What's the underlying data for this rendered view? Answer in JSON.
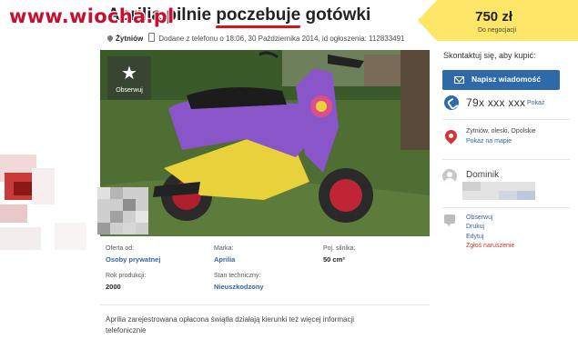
{
  "watermark": "www.wiocha.pl",
  "ad": {
    "title_prefix": "Aprilia pilnie ",
    "title_underlined": "poczebuje",
    "title_suffix": " gotówki",
    "location_short": "Żytniów",
    "meta": "Dodane z telefonu o 18:06, 30 Października 2014, id ogłoszenia: 112833491"
  },
  "price": {
    "amount": "750 zł",
    "note": "Do negocjacji"
  },
  "photo": {
    "observe_label": "Obserwuj",
    "colors": {
      "grass": "#4f6e33",
      "body": "#8a55c8",
      "accent_yellow": "#e8d13a",
      "wheel": "#c02536"
    }
  },
  "details": {
    "offer_from_label": "Oferta od:",
    "offer_from_value": "Osoby prywatnej",
    "brand_label": "Marka:",
    "brand_value": "Aprilia",
    "engine_label": "Poj. silnika:",
    "engine_value": "50 cm³",
    "year_label": "Rok produkcji:",
    "year_value": "2000",
    "condition_label": "Stan techniczny:",
    "condition_value": "Nieuszkodzony"
  },
  "description_line1": "Aprilia zarejestrowana opłacona świątła działają kierunki też więcej informacji",
  "description_line2": "telefonicznie",
  "contact": {
    "heading": "Skontaktuj się, aby kupić:",
    "message_button": "Napisz wiadomość",
    "phone": "79x xxx xxx",
    "show_phone": "Pokaż",
    "location": "Żytniów, oleski, Opolskie",
    "show_map": "Pokaż na mapie",
    "user_name": "Dominik",
    "actions": [
      "Obserwuj",
      "Drukuj",
      "Edytuj",
      "Zgłoś naruszenie"
    ]
  },
  "icons": [
    "location-pin-icon",
    "phone-icon",
    "star-icon",
    "envelope-icon",
    "map-pin-icon",
    "user-icon",
    "comment-icon"
  ]
}
